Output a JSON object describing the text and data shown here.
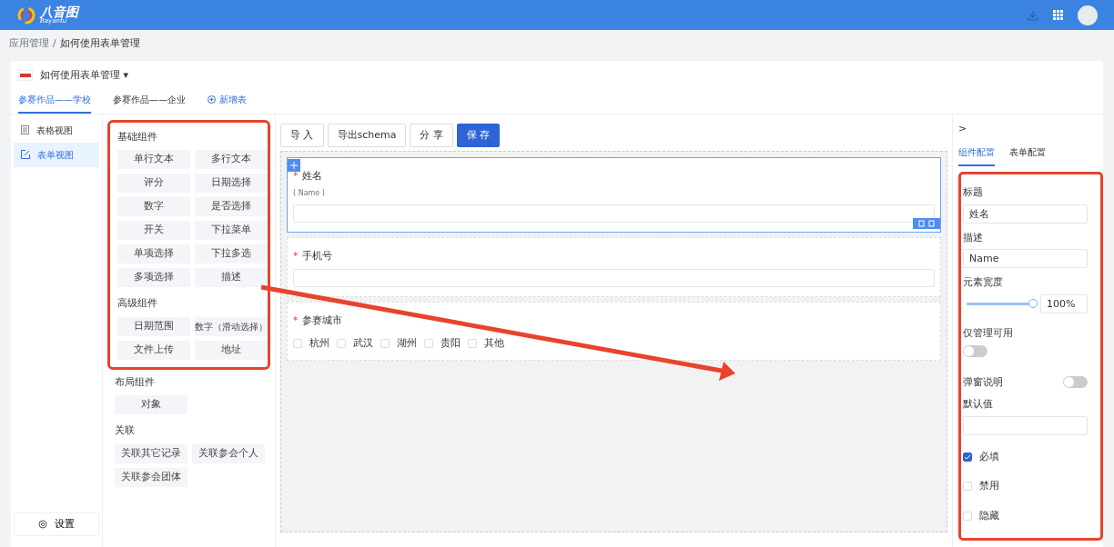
{
  "topbar": {
    "logo_cn": "八音图",
    "logo_en": "Bayantu"
  },
  "breadcrumb": [
    "应用管理",
    "如何使用表单管理"
  ],
  "breadcrumb_separator": "/",
  "collapse_toggle": ">",
  "required_mark": "*",
  "app": {
    "name": "如何使用表单管理",
    "caret": "▾"
  },
  "tabs": [
    {
      "label": "参赛作品——学校",
      "selected": true
    },
    {
      "label": "参赛作品——企业",
      "selected": false
    }
  ],
  "add_table": "新增表",
  "views": [
    {
      "label": "表格视图",
      "selected": false
    },
    {
      "label": "表单视图",
      "selected": true
    }
  ],
  "settings": "设置",
  "palette": [
    {
      "title": "基础组件",
      "framed": true,
      "items": [
        "单行文本",
        "多行文本",
        "评分",
        "日期选择",
        "数字",
        "是否选择",
        "开关",
        "下拉菜单",
        "单项选择",
        "下拉多选",
        "多项选择",
        "描述"
      ]
    },
    {
      "title": "高级组件",
      "framed": true,
      "items": [
        "日期范围",
        "数字（滑动选择）",
        "文件上传",
        "地址"
      ]
    },
    {
      "title": "布局组件",
      "framed": false,
      "items": [
        "对象"
      ]
    },
    {
      "title": "关联",
      "framed": false,
      "items": [
        "关联其它记录",
        "关联参会个人",
        "关联参会团体"
      ]
    }
  ],
  "toolbar": [
    {
      "label": "导 入",
      "primary": false
    },
    {
      "label": "导出schema",
      "primary": false
    },
    {
      "label": "分 享",
      "primary": false
    },
    {
      "label": "保 存",
      "primary": true
    }
  ],
  "form_fields": [
    {
      "kind": "text",
      "label": "姓名",
      "required": true,
      "description": "( Name )",
      "selected": true
    },
    {
      "kind": "text",
      "label": "手机号",
      "required": true,
      "selected": false
    },
    {
      "kind": "checkboxes",
      "label": "参赛城市",
      "required": true,
      "selected": false,
      "options": [
        "杭州",
        "武汉",
        "湖州",
        "贵阳",
        "其他"
      ]
    }
  ],
  "config_tabs": [
    {
      "label": "组件配置",
      "selected": true
    },
    {
      "label": "表单配置",
      "selected": false
    }
  ],
  "config_fields": [
    {
      "kind": "text",
      "label": "标题",
      "value": "姓名"
    },
    {
      "kind": "text",
      "label": "描述",
      "value": "Name"
    },
    {
      "kind": "slider",
      "label": "元素宽度",
      "level": 1,
      "reading": "100%"
    },
    {
      "kind": "switch",
      "label": "仅管理可用",
      "on": false
    },
    {
      "kind": "switch_inline",
      "label": "弹窗说明",
      "on": false
    },
    {
      "kind": "text",
      "label": "默认值"
    },
    {
      "kind": "checkbox",
      "label": "必填",
      "checked": true
    },
    {
      "kind": "checkbox",
      "label": "禁用",
      "checked": false
    },
    {
      "kind": "checkbox",
      "label": "隐藏",
      "checked": false
    }
  ],
  "annotation": {
    "config_frame": true,
    "arrow": true
  }
}
